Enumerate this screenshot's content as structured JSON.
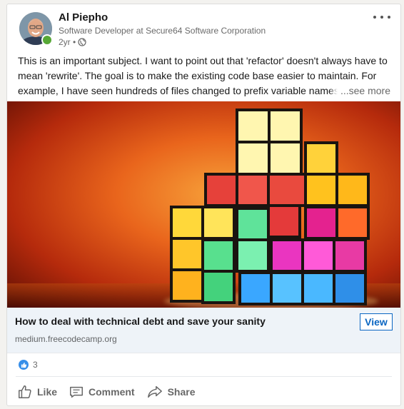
{
  "post": {
    "author_name": "Al Piepho",
    "author_headline": "Software Developer at Secure64 Software Corporation",
    "timestamp": "2yr •",
    "visibility_icon": "globe-icon",
    "text": "This is an important subject. I want to point out that 'refactor' doesn't always have to mean 'rewrite'. The goal is to make the existing code base easier to maintain. For example, I have seen hundreds of files changed to prefix variable names t",
    "see_more_label": "...see more"
  },
  "link_preview": {
    "title": "How to deal with technical debt and save your sanity",
    "source": "medium.freecodecamp.org",
    "view_label": "View"
  },
  "social": {
    "reaction_count": "3",
    "reaction_icon": "like-reaction-icon"
  },
  "actions": {
    "like_label": "Like",
    "comment_label": "Comment",
    "share_label": "Share"
  },
  "colors": {
    "accent": "#0a66c2",
    "presence": "#57a836",
    "link_bg": "#eef3f8"
  }
}
